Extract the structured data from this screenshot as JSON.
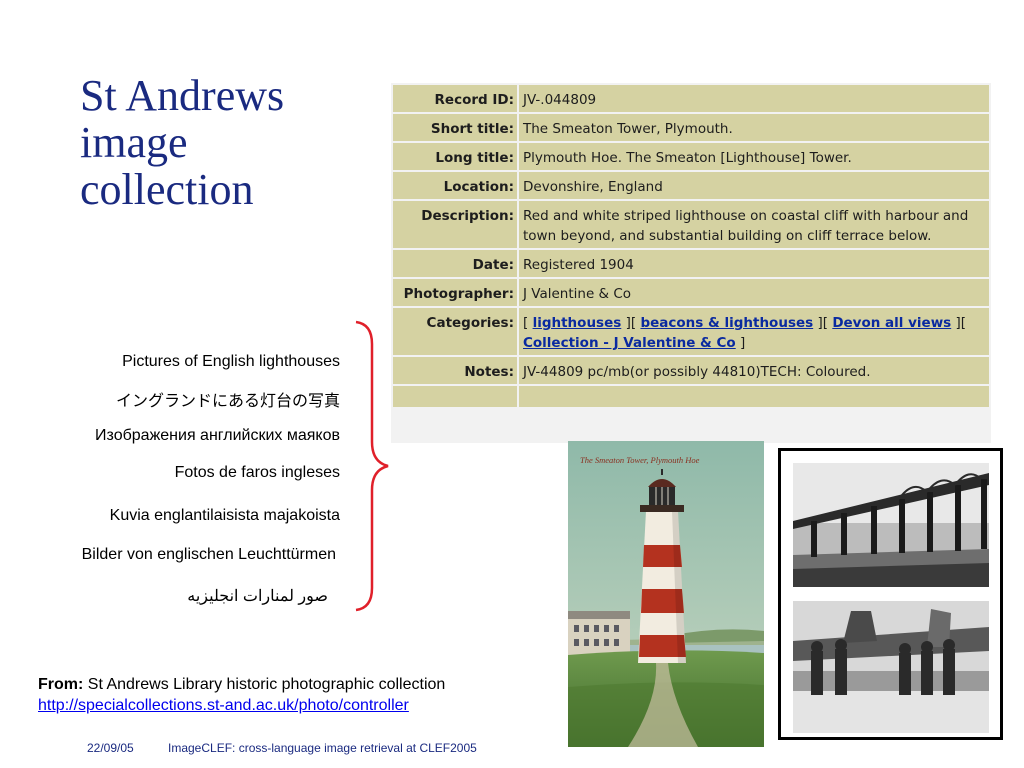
{
  "slide": {
    "title_lines": [
      "St Andrews",
      "image",
      "collection"
    ]
  },
  "record": {
    "rows": [
      {
        "label": "Record ID:",
        "value": "JV-.044809"
      },
      {
        "label": "Short title:",
        "value": "The Smeaton Tower, Plymouth."
      },
      {
        "label": "Long title:",
        "value": "Plymouth Hoe. The Smeaton [Lighthouse] Tower."
      },
      {
        "label": "Location:",
        "value": "Devonshire, England"
      },
      {
        "label": "Description:",
        "value": "Red and white striped lighthouse on coastal cliff with harbour and town beyond, and substantial building on cliff terrace below."
      },
      {
        "label": "Date:",
        "value": "Registered 1904"
      },
      {
        "label": "Photographer:",
        "value": "J Valentine & Co"
      },
      {
        "label": "Categories:",
        "open": "[",
        "links": [
          "lighthouses",
          "beacons & lighthouses",
          "Devon all views",
          "Collection - J Valentine & Co"
        ],
        "sep": "][",
        "close": "]"
      },
      {
        "label": "Notes:",
        "value": "JV-44809 pc/mb(or possibly 44810)TECH: Coloured."
      }
    ]
  },
  "languages": [
    "Pictures of English lighthouses",
    "イングランドにある灯台の写真",
    "Изображения английских маяков",
    "Fotos de faros ingleses",
    "Kuvia englantilaisista majakoista",
    "Bilder von englischen Leuchttürmen",
    "صور لمنارات انجليزيه"
  ],
  "photos": {
    "postcard_caption": "The Smeaton Tower, Plymouth Hoe"
  },
  "source": {
    "from_label": "From:",
    "from_text": "St Andrews Library historic photographic collection",
    "url": "http://specialcollections.st-and.ac.uk/photo/controller"
  },
  "footer": {
    "date": "22/09/05",
    "title": "ImageCLEF: cross-language image retrieval at CLEF2005"
  },
  "colors": {
    "title": "#1a2a80",
    "table_cell": "#d5d2a2",
    "bracket": "#e0202a",
    "link": "#0000ee"
  }
}
